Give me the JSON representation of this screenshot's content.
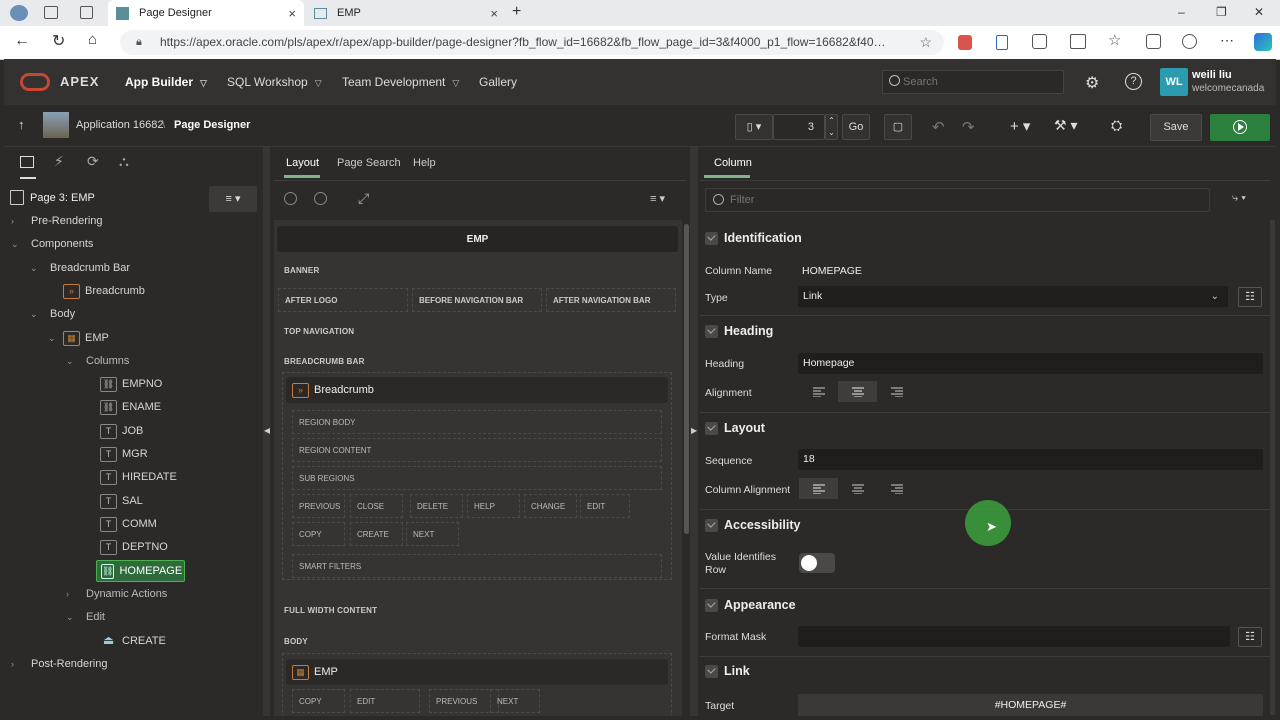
{
  "browser": {
    "tabs": [
      {
        "title": "Page Designer",
        "close": "×"
      },
      {
        "title": "EMP",
        "close": "×"
      }
    ],
    "new_tab": "+",
    "url": "https://apex.oracle.com/pls/apex/r/apex/app-builder/page-designer?fb_flow_id=16682&fb_flow_page_id=3&f4000_p1_flow=16682&f40…",
    "window_controls": [
      "–",
      "❐",
      "✕"
    ]
  },
  "apex_header": {
    "brand": "APEX",
    "nav": [
      "App Builder",
      "SQL Workshop",
      "Team Development",
      "Gallery"
    ],
    "search_placeholder": "Search",
    "user": {
      "initials": "WL",
      "name": "weili liu",
      "workspace": "welcomecanada"
    }
  },
  "toolbar": {
    "app_label": "Application 16682",
    "separator": "\\",
    "page_designer_label": "Page Designer",
    "page_number": "3",
    "go_label": "Go",
    "save_label": "Save"
  },
  "left_tree": {
    "page_label": "Page 3: EMP",
    "items": [
      {
        "label": "Pre-Rendering"
      },
      {
        "label": "Components"
      },
      {
        "label": "Breadcrumb Bar"
      },
      {
        "label": "Breadcrumb"
      },
      {
        "label": "Body"
      },
      {
        "label": "EMP"
      },
      {
        "label": "Columns"
      },
      {
        "label": "EMPNO"
      },
      {
        "label": "ENAME"
      },
      {
        "label": "JOB"
      },
      {
        "label": "MGR"
      },
      {
        "label": "HIREDATE"
      },
      {
        "label": "SAL"
      },
      {
        "label": "COMM"
      },
      {
        "label": "DEPTNO"
      },
      {
        "label": "HOMEPAGE"
      },
      {
        "label": "Dynamic Actions"
      },
      {
        "label": "Edit"
      },
      {
        "label": "CREATE"
      },
      {
        "label": "Post-Rendering"
      }
    ]
  },
  "middle": {
    "tabs": [
      "Layout",
      "Page Search",
      "Help"
    ],
    "page_title": "EMP",
    "sections": {
      "banner": "BANNER",
      "after_logo": "AFTER LOGO",
      "before_nav": "BEFORE NAVIGATION BAR",
      "after_nav": "AFTER NAVIGATION BAR",
      "top_nav": "TOP NAVIGATION",
      "breadcrumb_bar": "BREADCRUMB BAR",
      "full_width": "FULL WIDTH CONTENT",
      "body": "BODY"
    },
    "breadcrumb_region": {
      "title": "Breadcrumb",
      "region_body": "REGION BODY",
      "region_content": "REGION CONTENT",
      "sub_regions": "SUB REGIONS",
      "buttons_row1": [
        "PREVIOUS",
        "CLOSE",
        "DELETE",
        "HELP",
        "CHANGE",
        "EDIT"
      ],
      "buttons_row2": [
        "COPY",
        "CREATE",
        "NEXT"
      ],
      "smart_filters": "SMART FILTERS"
    },
    "emp_region": {
      "title": "EMP",
      "buttons": [
        "COPY",
        "EDIT",
        "PREVIOUS",
        "NEXT"
      ]
    }
  },
  "right": {
    "tab": "Column",
    "filter_placeholder": "Filter",
    "groups": {
      "identification": "Identification",
      "heading": "Heading",
      "layout": "Layout",
      "accessibility": "Accessibility",
      "appearance": "Appearance",
      "link": "Link"
    },
    "fields": {
      "column_name_label": "Column Name",
      "column_name_value": "HOMEPAGE",
      "type_label": "Type",
      "type_value": "Link",
      "heading_label": "Heading",
      "heading_value": "Homepage",
      "alignment_label": "Alignment",
      "sequence_label": "Sequence",
      "sequence_value": "18",
      "column_alignment_label": "Column Alignment",
      "value_identifies_row_label": "Value Identifies Row",
      "value_identifies_row": false,
      "format_mask_label": "Format Mask",
      "format_mask_value": "",
      "target_label": "Target",
      "target_value": "#HOMEPAGE#"
    }
  },
  "colors": {
    "accent_green": "#2d7f3e",
    "selected_node": "#2f6b3a",
    "apex_red": "#c74634"
  }
}
